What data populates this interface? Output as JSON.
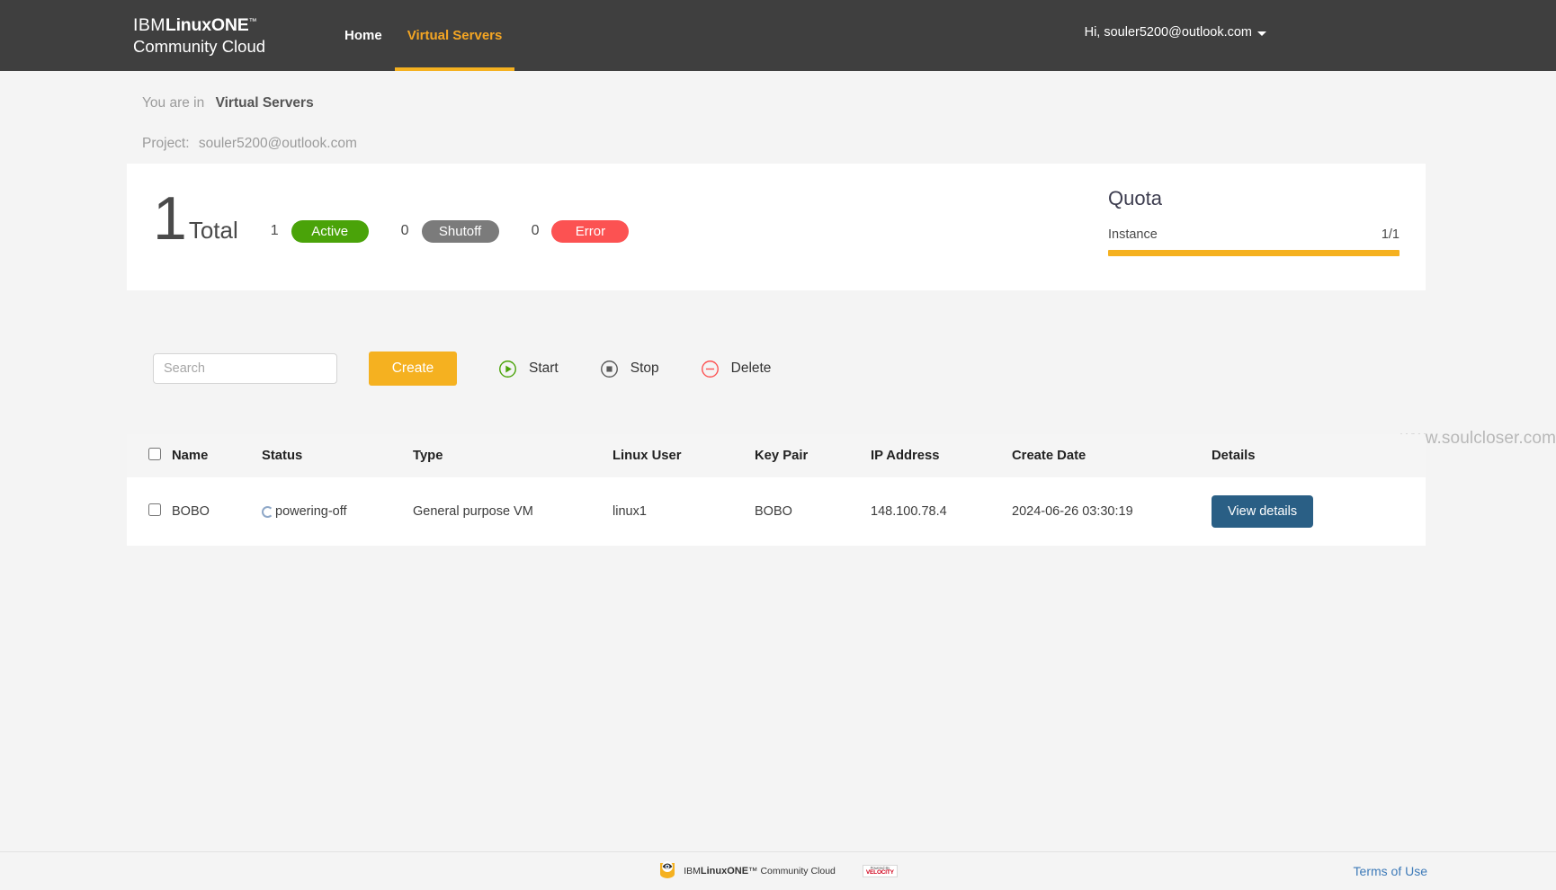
{
  "header": {
    "brand_ibm": "IBM",
    "brand_linuxone": "LinuxONE",
    "brand_tm": "™",
    "brand_line2": "Community Cloud",
    "nav": [
      {
        "label": "Home",
        "active": false
      },
      {
        "label": "Virtual Servers",
        "active": true
      }
    ],
    "user_greeting": "Hi, souler5200@outlook.com"
  },
  "breadcrumb": {
    "prefix": "You are in",
    "current": "Virtual Servers",
    "project_label": "Project:",
    "project_value": "souler5200@outlook.com"
  },
  "summary": {
    "total_count": "1",
    "total_label": "Total",
    "stats": [
      {
        "count": "1",
        "label": "Active",
        "color": "#4aa309"
      },
      {
        "count": "0",
        "label": "Shutoff",
        "color": "#7b7b7b"
      },
      {
        "count": "0",
        "label": "Error",
        "color": "#fc5252"
      }
    ]
  },
  "quota": {
    "title": "Quota",
    "item_label": "Instance",
    "item_value": "1/1",
    "bar_percent": 100,
    "bar_color": "#f5b120"
  },
  "toolbar": {
    "search_placeholder": "Search",
    "search_value": "",
    "create_label": "Create",
    "start_label": "Start",
    "stop_label": "Stop",
    "delete_label": "Delete"
  },
  "table": {
    "columns": [
      "Name",
      "Status",
      "Type",
      "Linux User",
      "Key Pair",
      "IP Address",
      "Create Date",
      "Details"
    ],
    "rows": [
      {
        "name": "BOBO",
        "status": "powering-off",
        "type": "General purpose VM",
        "linux_user": "linux1",
        "key_pair": "BOBO",
        "ip_address": "148.100.78.4",
        "create_date": "2024-06-26 03:30:19",
        "details_label": "View details"
      }
    ]
  },
  "watermark": "www.soulcloser.com",
  "footer": {
    "brand_ibm": "IBM",
    "brand_linuxone": "LinuxONE",
    "brand_tm": "™",
    "brand_suffix": "Community Cloud",
    "powered_line1": "Powered By",
    "powered_line2": "VELOCITY",
    "terms_label": "Terms of Use"
  }
}
